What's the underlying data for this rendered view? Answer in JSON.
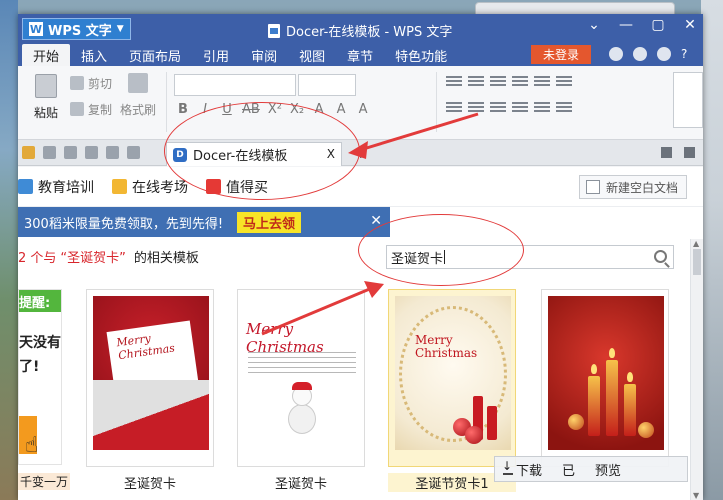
{
  "titlebar": {
    "app_name": "WPS 文字",
    "app_logo": "W",
    "window_title": "Docer-在线模板 - WPS 文字",
    "controls": [
      "⌄",
      "—",
      "▢",
      "✕"
    ]
  },
  "menubar": {
    "items": [
      "开始",
      "插入",
      "页面布局",
      "引用",
      "审阅",
      "视图",
      "章节",
      "特色功能"
    ],
    "login_label": "未登录",
    "help_label": "?"
  },
  "ribbon": {
    "paste_label": "粘贴",
    "cut_label": "剪切",
    "copy_label": "复制",
    "format_painter_label": "格式刷",
    "format_buttons": [
      "B",
      "I",
      "U",
      "AB",
      "X²",
      "X₂",
      "A",
      "A",
      "A"
    ]
  },
  "tabbar": {
    "doc_tab_label": "Docer-在线模板",
    "doc_tab_icon": "D",
    "close_label": "X",
    "new_tab_label": "+"
  },
  "docer": {
    "nav": [
      "教育培训",
      "在线考场",
      "值得买"
    ],
    "new_blank_doc_label": "新建空白文档",
    "promo_text": "300稻米限量免费领取，先到先得!",
    "promo_button": "马上去领",
    "promo_close": "✕",
    "result_prefix": "2 个与",
    "result_keyword": "“圣诞贺卡”",
    "result_suffix": "的相关模板",
    "search_value": "圣诞贺卡",
    "side_ad": {
      "head": "提醒:",
      "line1": "天没有",
      "line2": "了!",
      "caption": "千变一万"
    },
    "cards": [
      {
        "caption": "圣诞贺卡",
        "art_text": "Merry Christmas"
      },
      {
        "caption": "圣诞贺卡",
        "art_text": "Merry Christmas"
      },
      {
        "caption": "圣诞节贺卡1",
        "art_text": "Merry Christmas"
      },
      {
        "caption": "",
        "art_text": ""
      }
    ],
    "action_bar": {
      "download_label": "下载",
      "partial_label_1": "已",
      "partial_label_2": "预览"
    }
  },
  "colors": {
    "title_bar": "#3d5fa8",
    "login_button": "#e4572e",
    "promo_bar": "#3f6fb3",
    "promo_button": "#f7e427",
    "accent_red": "#d8262c",
    "annotation": "#e23b3b"
  }
}
